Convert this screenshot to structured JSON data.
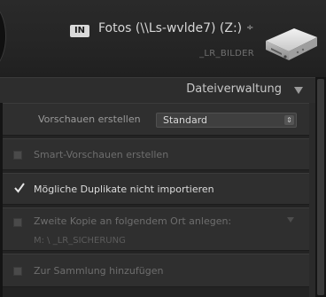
{
  "source": {
    "badge": "IN",
    "name": "Fotos (\\\\Ls-wvlde7) (Z:)",
    "chevron": "÷",
    "subtitle": "_LR_BILDER",
    "icon": "external-drive-icon"
  },
  "panel": {
    "title": "Dateiverwaltung",
    "toggle_icon": "triangle-down-icon"
  },
  "previews": {
    "label": "Vorschauen erstellen",
    "value": "Standard"
  },
  "options": [
    {
      "label": "Smart-Vorschauen erstellen",
      "checked": false
    },
    {
      "label": "Mögliche Duplikate nicht importieren",
      "checked": true
    },
    {
      "label": "Zweite Kopie an folgendem Ort anlegen:",
      "checked": false
    },
    {
      "label": "Zur Sammlung hinzufügen",
      "checked": false
    }
  ],
  "second_copy": {
    "path": "M: \\ _LR_SICHERUNG"
  }
}
